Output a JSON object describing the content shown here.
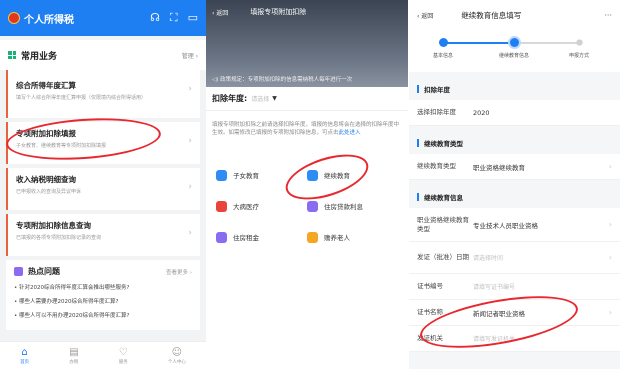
{
  "app": {
    "title": "个人所得税"
  },
  "home": {
    "section_title": "常用业务",
    "section_manage": "管理 ›",
    "items": [
      {
        "title": "综合所得年度汇算",
        "subtitle": "填写个人综合所得年度汇算申报（仅限境内综合所得适用）"
      },
      {
        "title": "专项附加扣除填报",
        "subtitle": "子女教育、继续教育等专项附加扣除填报"
      },
      {
        "title": "收入纳税明细查询",
        "subtitle": "已申报收入的查询及异议申诉"
      },
      {
        "title": "专项附加扣除信息查询",
        "subtitle": "已填报的各项专项附加扣除记录的查询"
      }
    ],
    "hot": {
      "title": "热点问题",
      "more": "查看更多 ›",
      "questions": [
        "• 针对2020综合所得年度汇算会推出哪些服务?",
        "• 哪些人需要办理2020综合所得年度汇算?",
        "• 哪些人可以不用办理2020综合所得年度汇算?"
      ]
    },
    "tabs": [
      "首页",
      "办税",
      "服务",
      "个人中心"
    ]
  },
  "deduction": {
    "back": "‹ 返回",
    "title": "填报专项附加扣除",
    "notice": "政策规定：专项附加扣除的信息需纳税人每年进行一次",
    "year_label": "扣除年度:",
    "year_placeholder": "请选择",
    "description": "填报专项附加扣除之前请选择扣除年度，填报的信息将会在选择的扣除年度中生效。如需修改已填报的专项附加扣除信息，可点击",
    "description_link": "此处进入",
    "options": [
      {
        "label": "子女教育",
        "color": "#2f8cf4"
      },
      {
        "label": "继续教育",
        "color": "#2f8cf4"
      },
      {
        "label": "大病医疗",
        "color": "#e8443b"
      },
      {
        "label": "住房贷款利息",
        "color": "#8a6cf0"
      },
      {
        "label": "住房租金",
        "color": "#8a6cf0"
      },
      {
        "label": "赡养老人",
        "color": "#f5a623"
      }
    ]
  },
  "form": {
    "back": "‹ 返回",
    "title": "继续教育信息填写",
    "more": "···",
    "steps": [
      "基本信息",
      "继续教育信息",
      "申报方式"
    ],
    "groups": [
      {
        "title": "扣除年度",
        "rows": [
          {
            "label": "选择扣除年度",
            "value": "2020",
            "placeholder": ""
          }
        ]
      },
      {
        "title": "继续教育类型",
        "rows": [
          {
            "label": "继续教育类型",
            "value": "职业资格继续教育",
            "placeholder": ""
          }
        ]
      },
      {
        "title": "继续教育信息",
        "rows": [
          {
            "label": "职业资格继续教育类型",
            "value": "专业技术人员职业资格",
            "placeholder": ""
          },
          {
            "label": "发证（批准）日期",
            "value": "",
            "placeholder": "请选择时间"
          },
          {
            "label": "证书编号",
            "value": "",
            "placeholder": "请填写证书编号"
          },
          {
            "label": "证书名称",
            "value": "新闻记者职业资格",
            "placeholder": ""
          },
          {
            "label": "发证机关",
            "value": "",
            "placeholder": "请填写发证机关"
          }
        ]
      }
    ]
  }
}
